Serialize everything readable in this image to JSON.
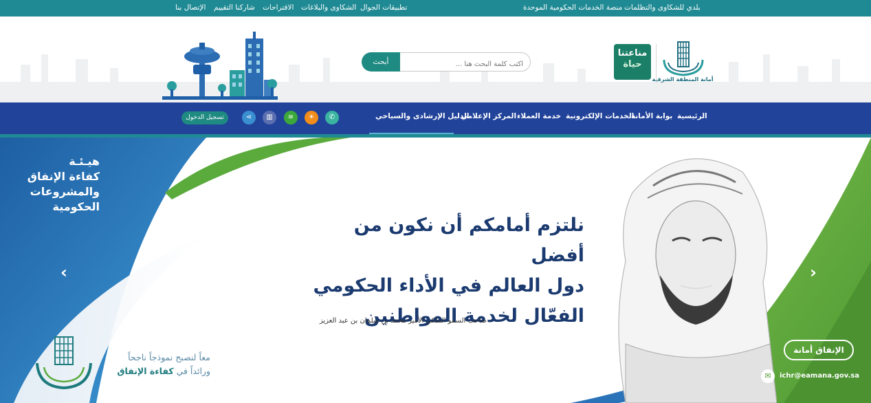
{
  "topbar": {
    "left_links": [
      "تطبيقات الجوال",
      "الشكاوى والبلاغات",
      "الاقتراحات",
      "شاركنا التقييم",
      "الإتصال بنا"
    ],
    "right_links": [
      "بلدي للشكاوى والتظلمات",
      "منصة الخدمات الحكومية الموحدة"
    ]
  },
  "header": {
    "search_placeholder": "أكتب كلمة البحث هنا ...",
    "search_button": "أبحث",
    "logo_amana_text": "أمانة المنطقة الشرقية",
    "logo_hayat_line1": "مناعتنا",
    "logo_hayat_line2": "حياة"
  },
  "nav": {
    "items": [
      "الرئيسية",
      "بوابة الأمانة",
      "الخدمات الإلكترونية",
      "خدمة العملاء",
      "المركز الإعلامي",
      "الدليل الإرشادى والسياحي"
    ],
    "login": "تسجيل الدخول",
    "icons": [
      "phone-icon",
      "sun-icon",
      "layers-icon",
      "book-icon",
      "share-icon"
    ]
  },
  "hero": {
    "org_name": [
      "هيـئـة",
      "كفاءة الإنفاق",
      "والمشروعات",
      "الحكومية"
    ],
    "headline": [
      "نلتزم أمامكم أن نكون من أفضل",
      "دول العالم في الأداء الحكومي",
      "الفعّال لخدمة المواطنين"
    ],
    "caption": "صاحب السمو الملكي الأمير محمد بن سلمان بن عبد العزيز",
    "slogan_line1": "معاً لنصبح نموذجاً ناجحاً",
    "slogan_line2_prefix": "ورائداً في ",
    "slogan_line2_bold": "كفاءة الإنفاق",
    "pill": "الإنفاق أمانة",
    "email": "ichr@eamana.gov.sa"
  },
  "colors": {
    "topbar": "#1f8a94",
    "nav": "#21439a",
    "green_button": "#1f8a82",
    "hero_blue": "#2a73b8",
    "hero_green": "#5a9f3a"
  }
}
